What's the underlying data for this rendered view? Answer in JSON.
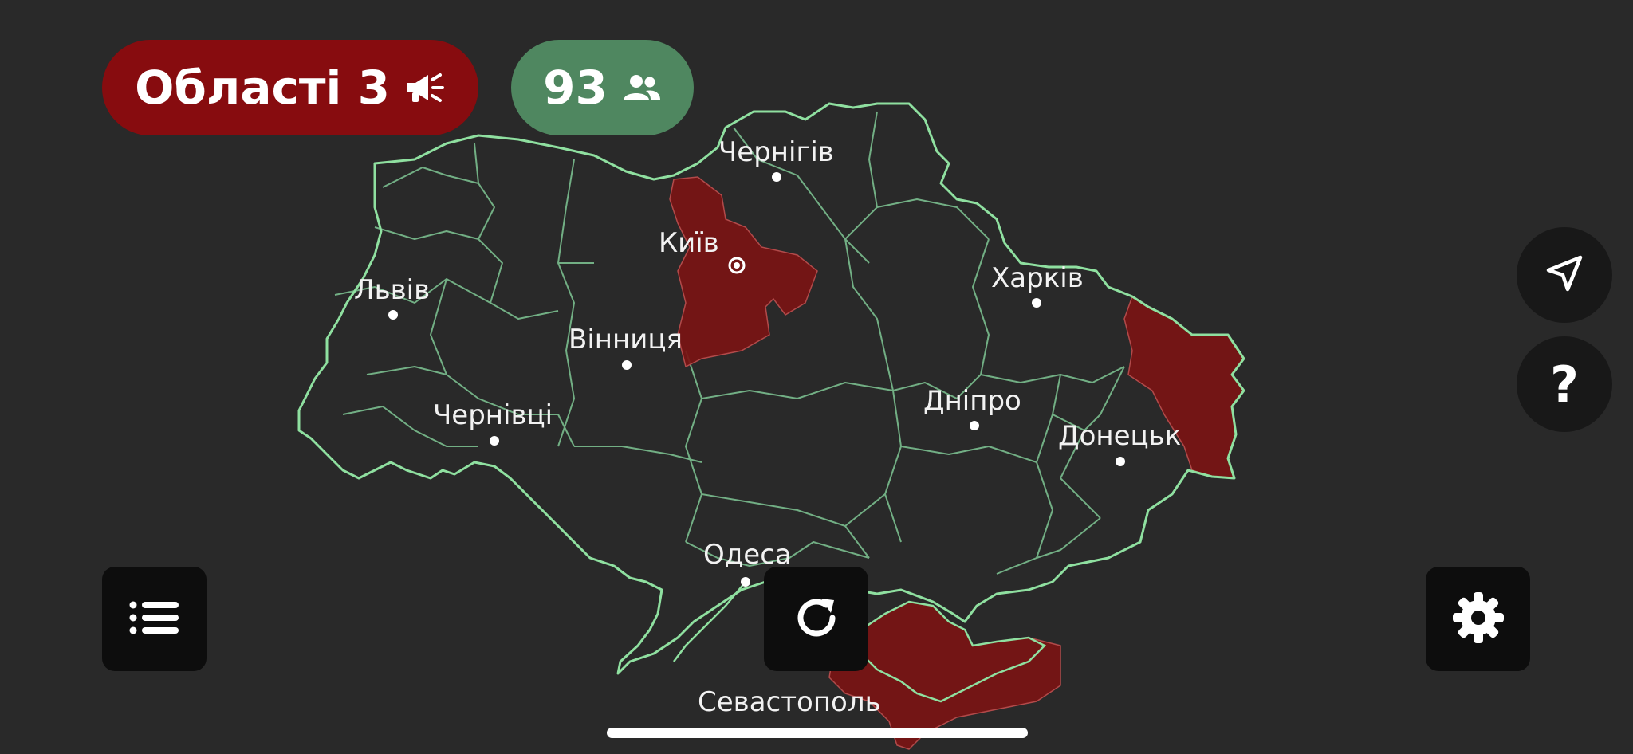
{
  "alerts": {
    "label": "Області",
    "count": "3",
    "icon": "megaphone-icon",
    "color": "#870c0f"
  },
  "users": {
    "count": "93",
    "icon": "users-icon",
    "color": "#4f8760"
  },
  "map": {
    "border_color": "#8fe0a0",
    "alert_color": "#7a1414",
    "cities": [
      {
        "name": "Чернігів"
      },
      {
        "name": "Київ"
      },
      {
        "name": "Харків"
      },
      {
        "name": "Львів"
      },
      {
        "name": "Вінниця"
      },
      {
        "name": "Дніпро"
      },
      {
        "name": "Чернівці"
      },
      {
        "name": "Донецьк"
      },
      {
        "name": "Одеса"
      },
      {
        "name": "Севастополь"
      }
    ]
  },
  "controls": {
    "locate": "navigation-arrow-icon",
    "help": "?",
    "list": "list-icon",
    "refresh": "refresh-icon",
    "settings": "gear-icon"
  }
}
